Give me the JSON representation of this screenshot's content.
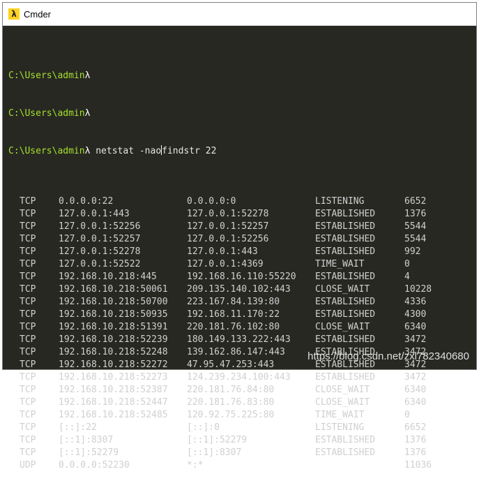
{
  "window": {
    "title": "Cmder",
    "icon": "lambda-icon"
  },
  "console": {
    "prompt": "C:\\Users\\admin",
    "lambda": "λ",
    "command_before_cursor": " netstat -nao",
    "command_after_cursor": "findstr 22",
    "rows": [
      {
        "proto": "TCP",
        "local": "0.0.0.0:22",
        "foreign": "0.0.0.0:0",
        "state": "LISTENING",
        "pid": "6652"
      },
      {
        "proto": "TCP",
        "local": "127.0.0.1:443",
        "foreign": "127.0.0.1:52278",
        "state": "ESTABLISHED",
        "pid": "1376"
      },
      {
        "proto": "TCP",
        "local": "127.0.0.1:52256",
        "foreign": "127.0.0.1:52257",
        "state": "ESTABLISHED",
        "pid": "5544"
      },
      {
        "proto": "TCP",
        "local": "127.0.0.1:52257",
        "foreign": "127.0.0.1:52256",
        "state": "ESTABLISHED",
        "pid": "5544"
      },
      {
        "proto": "TCP",
        "local": "127.0.0.1:52278",
        "foreign": "127.0.0.1:443",
        "state": "ESTABLISHED",
        "pid": "992"
      },
      {
        "proto": "TCP",
        "local": "127.0.0.1:52522",
        "foreign": "127.0.0.1:4369",
        "state": "TIME_WAIT",
        "pid": "0"
      },
      {
        "proto": "TCP",
        "local": "192.168.10.218:445",
        "foreign": "192.168.16.110:55220",
        "state": "ESTABLISHED",
        "pid": "4"
      },
      {
        "proto": "TCP",
        "local": "192.168.10.218:50061",
        "foreign": "209.135.140.102:443",
        "state": "CLOSE_WAIT",
        "pid": "10228"
      },
      {
        "proto": "TCP",
        "local": "192.168.10.218:50700",
        "foreign": "223.167.84.139:80",
        "state": "ESTABLISHED",
        "pid": "4336"
      },
      {
        "proto": "TCP",
        "local": "192.168.10.218:50935",
        "foreign": "192.168.11.170:22",
        "state": "ESTABLISHED",
        "pid": "4300"
      },
      {
        "proto": "TCP",
        "local": "192.168.10.218:51391",
        "foreign": "220.181.76.102:80",
        "state": "CLOSE_WAIT",
        "pid": "6340"
      },
      {
        "proto": "TCP",
        "local": "192.168.10.218:52239",
        "foreign": "180.149.133.222:443",
        "state": "ESTABLISHED",
        "pid": "3472"
      },
      {
        "proto": "TCP",
        "local": "192.168.10.218:52248",
        "foreign": "139.162.86.147:443",
        "state": "ESTABLISHED",
        "pid": "3472"
      },
      {
        "proto": "TCP",
        "local": "192.168.10.218:52272",
        "foreign": "47.95.47.253:443",
        "state": "ESTABLISHED",
        "pid": "3472"
      },
      {
        "proto": "TCP",
        "local": "192.168.10.218:52273",
        "foreign": "124.239.234.100:443",
        "state": "ESTABLISHED",
        "pid": "3472"
      },
      {
        "proto": "TCP",
        "local": "192.168.10.218:52387",
        "foreign": "220.181.76.84:80",
        "state": "CLOSE_WAIT",
        "pid": "6340"
      },
      {
        "proto": "TCP",
        "local": "192.168.10.218:52447",
        "foreign": "220.181.76.83:80",
        "state": "CLOSE_WAIT",
        "pid": "6340"
      },
      {
        "proto": "TCP",
        "local": "192.168.10.218:52485",
        "foreign": "120.92.75.225:80",
        "state": "TIME_WAIT",
        "pid": "0"
      },
      {
        "proto": "TCP",
        "local": "[::]:22",
        "foreign": "[::]:0",
        "state": "LISTENING",
        "pid": "6652"
      },
      {
        "proto": "TCP",
        "local": "[::1]:8307",
        "foreign": "[::1]:52279",
        "state": "ESTABLISHED",
        "pid": "1376"
      },
      {
        "proto": "TCP",
        "local": "[::1]:52279",
        "foreign": "[::1]:8307",
        "state": "ESTABLISHED",
        "pid": "1376"
      },
      {
        "proto": "UDP",
        "local": "0.0.0.0:52230",
        "foreign": "*:*",
        "state": "",
        "pid": "11036"
      }
    ]
  },
  "watermark": "https://blog.csdn.net/zxl782340680"
}
